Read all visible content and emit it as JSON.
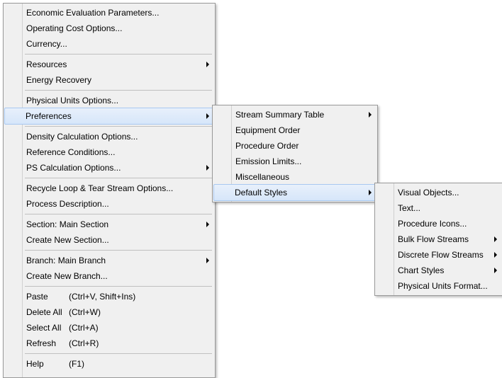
{
  "menu1": {
    "items": [
      {
        "label": "Economic Evaluation Parameters..."
      },
      {
        "label": "Operating Cost Options..."
      },
      {
        "label": "Currency..."
      },
      {
        "sep": true
      },
      {
        "label": "Resources",
        "submenu": true
      },
      {
        "label": "Energy Recovery"
      },
      {
        "sep": true
      },
      {
        "label": "Physical Units Options..."
      },
      {
        "label": "Preferences",
        "submenu": true,
        "highlight": true
      },
      {
        "sep": true
      },
      {
        "label": "Density Calculation Options..."
      },
      {
        "label": "Reference Conditions..."
      },
      {
        "label": "PS Calculation Options...",
        "submenu": true
      },
      {
        "sep": true
      },
      {
        "label": "Recycle Loop & Tear Stream Options..."
      },
      {
        "label": "Process Description..."
      },
      {
        "sep": true
      },
      {
        "label": "Section: Main Section",
        "submenu": true
      },
      {
        "label": "Create New Section..."
      },
      {
        "sep": true
      },
      {
        "label": "Branch: Main Branch",
        "submenu": true
      },
      {
        "label": "Create New Branch..."
      },
      {
        "sep": true
      },
      {
        "label": "Paste",
        "shortcut": "(Ctrl+V, Shift+Ins)"
      },
      {
        "label": "Delete All",
        "shortcut": "(Ctrl+W)"
      },
      {
        "label": "Select All",
        "shortcut": "(Ctrl+A)"
      },
      {
        "label": "Refresh",
        "shortcut": "(Ctrl+R)"
      },
      {
        "sep": true
      },
      {
        "label": "Help",
        "shortcut": "(F1)"
      }
    ]
  },
  "menu2": {
    "items": [
      {
        "label": "Stream Summary Table",
        "submenu": true
      },
      {
        "label": "Equipment Order"
      },
      {
        "label": "Procedure Order"
      },
      {
        "label": "Emission Limits..."
      },
      {
        "label": "Miscellaneous"
      },
      {
        "label": "Default Styles",
        "submenu": true,
        "highlight": true
      }
    ]
  },
  "menu3": {
    "items": [
      {
        "label": "Visual Objects..."
      },
      {
        "label": "Text..."
      },
      {
        "label": "Procedure Icons..."
      },
      {
        "label": "Bulk Flow Streams",
        "submenu": true
      },
      {
        "label": "Discrete Flow Streams",
        "submenu": true
      },
      {
        "label": "Chart Styles",
        "submenu": true
      },
      {
        "label": "Physical Units Format..."
      }
    ]
  }
}
